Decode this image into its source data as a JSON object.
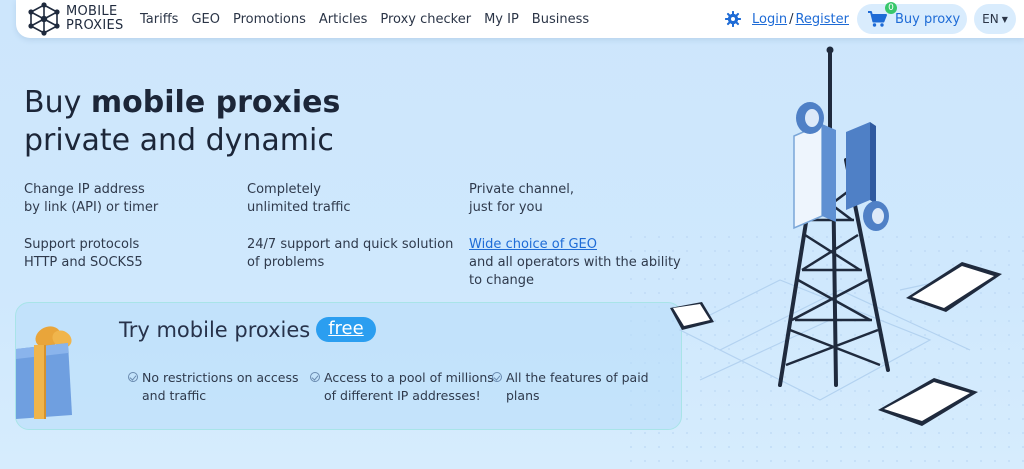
{
  "brand": {
    "line1": "MOBILE",
    "line2": "PROXIES"
  },
  "nav": [
    "Tariffs",
    "GEO",
    "Promotions",
    "Articles",
    "Proxy checker",
    "My IP",
    "Business"
  ],
  "auth": {
    "login": "Login",
    "separator": "/",
    "register": "Register"
  },
  "cart": {
    "label": "Buy proxy",
    "count": "0"
  },
  "language": "EN",
  "hero": {
    "title_bold": "Buy mobile proxies",
    "title_bold_part": "mobile proxies",
    "title_plain": "Buy",
    "title_line2": "private and dynamic"
  },
  "features": [
    {
      "line1": "Change IP address",
      "line2": "by link (API) or timer"
    },
    {
      "line1": "Completely",
      "line2": "unlimited traffic"
    },
    {
      "line1": "Private channel,",
      "line2": "just for you"
    },
    {
      "line1": "Support protocols",
      "line2": "HTTP and SOCKS5"
    },
    {
      "line1": "24/7 support and quick solution",
      "line2": "of problems"
    },
    {
      "link": "Wide choice of GEO",
      "line2": "and all operators with the ability",
      "line3": "to change"
    }
  ],
  "promo": {
    "title": "Try mobile proxies",
    "free": "free",
    "items": [
      {
        "line1": "No restrictions on access",
        "line2": "and traffic"
      },
      {
        "line1": "Access to a pool of millions",
        "line2": "of different IP addresses!"
      },
      {
        "line1": "All the features of paid",
        "line2": "plans"
      }
    ]
  },
  "colors": {
    "accent": "#1e6bd6",
    "badge": "#38c76b",
    "free_pill": "#2b9ef0",
    "background": "#cde6fc"
  },
  "icons": [
    "network-logo-icon",
    "gear-icon",
    "cart-icon",
    "chevron-down-icon",
    "check-circle-icon",
    "gift-box-icon",
    "cell-tower-illustration",
    "smartphone-icon"
  ]
}
